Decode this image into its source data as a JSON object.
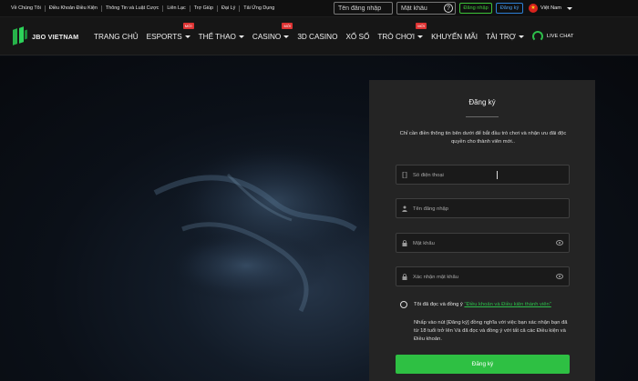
{
  "topbar": {
    "links": [
      "Về Chúng Tôi",
      "Điều Khoản Điều Kiện",
      "Thông Tin và Luật Cược",
      "Liên Lạc",
      "Trợ Giúp",
      "Đại Lý",
      "Tải Ứng Dụng"
    ],
    "username_placeholder": "Tên đăng nhập",
    "password_placeholder": "Mật khẩu",
    "help_glyph": "?",
    "login_label": "Đăng nhập",
    "register_label": "Đăng ký",
    "language": "Việt Nam",
    "flag_icon": "vietnam-flag-icon"
  },
  "nav": {
    "logo_text": "JBO VIETNAM",
    "items": [
      {
        "label": "TRANG CHỦ",
        "caret": false,
        "badge": ""
      },
      {
        "label": "ESPORTS",
        "caret": true,
        "badge": "MỚI"
      },
      {
        "label": "THỂ THAO",
        "caret": true,
        "badge": ""
      },
      {
        "label": "CASINO",
        "caret": true,
        "badge": "MỚI"
      },
      {
        "label": "3D CASINO",
        "caret": false,
        "badge": ""
      },
      {
        "label": "XỔ SỐ",
        "caret": false,
        "badge": ""
      },
      {
        "label": "TRÒ CHƠI",
        "caret": true,
        "badge": "MỚI"
      },
      {
        "label": "KHUYẾN MÃI",
        "caret": false,
        "badge": ""
      },
      {
        "label": "TÀI TRỢ",
        "caret": true,
        "badge": ""
      }
    ],
    "live_chat_label": "LIVE CHAT"
  },
  "register": {
    "title": "Đăng ký",
    "intro": "Chỉ cần điền thông tin bên dưới để bắt đầu trò chơi và nhận ưu đãi độc quyền cho thành viên mới..",
    "phone_placeholder": "Số điện thoại",
    "username_placeholder": "Tên đăng nhập",
    "password_placeholder": "Mật khẩu",
    "confirm_placeholder": "Xác nhận mật khẩu",
    "agree_prefix": "Tôi đã đọc và đồng ý ",
    "agree_link": "\"Điều khoản và Điều kiện thành viên\"",
    "notice": "Nhấp vào nút [Đăng ký] đồng nghĩa với việc bạn xác nhận bạn đã từ 18 tuổi trở lên Và đã đọc và đồng ý với tất cả các Điều kiện và Điều khoản.",
    "submit_label": "Đăng ký"
  },
  "colors": {
    "accent_green": "#2ec043",
    "accent_blue": "#2d80d6",
    "badge_red": "#d33333",
    "panel_bg": "#242424"
  }
}
